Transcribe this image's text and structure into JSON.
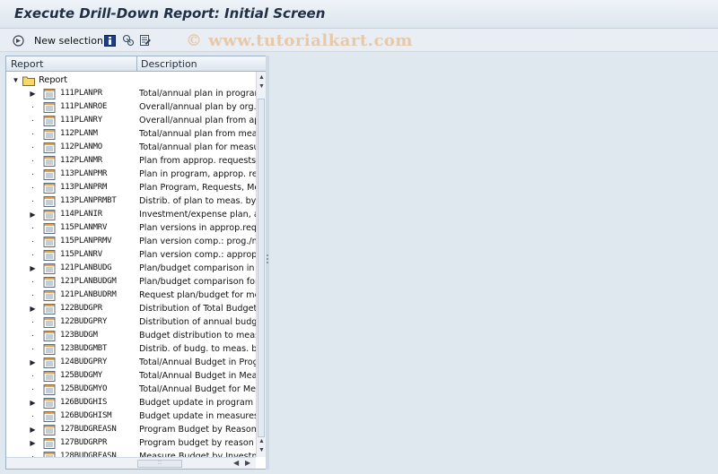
{
  "window": {
    "title": "Execute Drill-Down Report: Initial Screen"
  },
  "toolbar": {
    "new_selection_label": "New selection",
    "icons": [
      "execute-icon",
      "info-icon",
      "hierarchy-icon",
      "variant-icon"
    ]
  },
  "watermark": "© www.tutorialkart.com",
  "tree": {
    "columns": [
      "Report",
      "Description"
    ],
    "root_label": "Report",
    "rows": [
      {
        "name": "111PLANPR",
        "desc": "Total/annual plan in program",
        "expandable": true
      },
      {
        "name": "111PLANROE",
        "desc": "Overall/annual plan by org. unit",
        "expandable": false
      },
      {
        "name": "111PLANRY",
        "desc": "Overall/annual plan from appropriation",
        "expandable": false
      },
      {
        "name": "112PLANM",
        "desc": "Total/annual plan from measures",
        "expandable": false
      },
      {
        "name": "112PLANMO",
        "desc": "Total/annual plan for measures",
        "expandable": false
      },
      {
        "name": "112PLANMR",
        "desc": "Plan from approp. requests",
        "expandable": false
      },
      {
        "name": "113PLANPMR",
        "desc": "Plan in program, approp. requests",
        "expandable": false
      },
      {
        "name": "113PLANPRM",
        "desc": "Plan Program, Requests, Measures",
        "expandable": false
      },
      {
        "name": "113PLANPRMBT",
        "desc": "Distrib. of plan to meas. by type",
        "expandable": false
      },
      {
        "name": "114PLANIR",
        "desc": "Investment/expense plan, approp.",
        "expandable": true
      },
      {
        "name": "115PLANMRV",
        "desc": "Plan versions in approp.requests",
        "expandable": false
      },
      {
        "name": "115PLANPRMV",
        "desc": "Plan version comp.: prog./meas.",
        "expandable": false
      },
      {
        "name": "115PLANRV",
        "desc": "Plan version comp.: appropriation",
        "expandable": false
      },
      {
        "name": "121PLANBUDG",
        "desc": "Plan/budget comparison in program",
        "expandable": true
      },
      {
        "name": "121PLANBUDGM",
        "desc": "Plan/budget comparison for measures",
        "expandable": false
      },
      {
        "name": "121PLANBUDRM",
        "desc": "Request plan/budget for measures",
        "expandable": false
      },
      {
        "name": "122BUDGPR",
        "desc": "Distribution of Total Budget",
        "expandable": true
      },
      {
        "name": "122BUDGPRY",
        "desc": "Distribution of annual budget",
        "expandable": false
      },
      {
        "name": "123BUDGM",
        "desc": "Budget distribution to measures",
        "expandable": false
      },
      {
        "name": "123BUDGMBT",
        "desc": "Distrib. of budg. to meas. by type",
        "expandable": false
      },
      {
        "name": "124BUDGPRY",
        "desc": "Total/Annual Budget in Program",
        "expandable": true
      },
      {
        "name": "125BUDGMY",
        "desc": "Total/Annual Budget in Measures",
        "expandable": false
      },
      {
        "name": "125BUDGMYO",
        "desc": "Total/Annual Budget for Measures",
        "expandable": false
      },
      {
        "name": "126BUDGHIS",
        "desc": "Budget update in program",
        "expandable": true
      },
      {
        "name": "126BUDGHISM",
        "desc": "Budget update in measures",
        "expandable": false
      },
      {
        "name": "127BUDGREASN",
        "desc": "Program Budget by Reason",
        "expandable": true
      },
      {
        "name": "127BUDGRPR",
        "desc": "Program budget by reason for",
        "expandable": true
      },
      {
        "name": "128BUDGREASN",
        "desc": "Measure Budget by Investment",
        "expandable": false
      }
    ]
  }
}
